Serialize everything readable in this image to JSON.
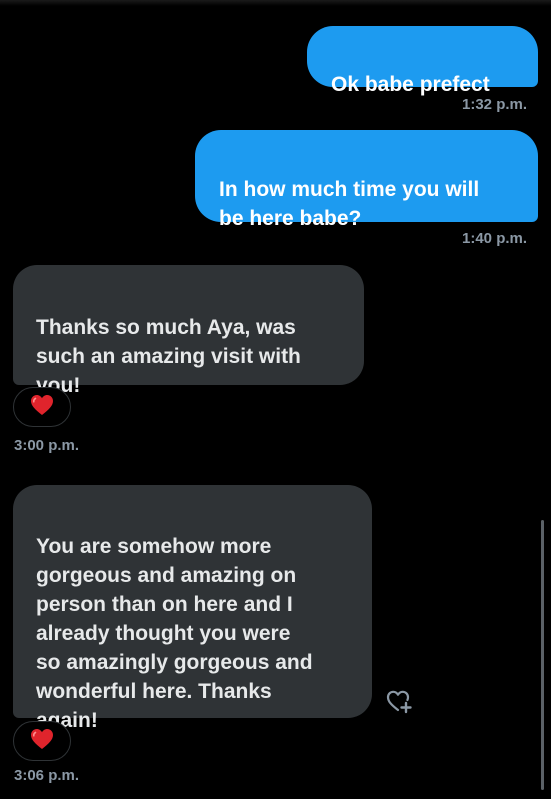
{
  "messages": [
    {
      "direction": "sent",
      "text": "Ok babe prefect",
      "time": "1:32 p.m."
    },
    {
      "direction": "sent",
      "text": "In how much time you will\nbe here babe?",
      "time": "1:40 p.m."
    },
    {
      "direction": "received",
      "text": "Thanks so much Aya, was\nsuch an amazing visit with\nyou!",
      "reaction": "heart",
      "time": "3:00 p.m."
    },
    {
      "direction": "received",
      "text": "You are somehow more\ngorgeous and amazing on\nperson than on here and I\nalready thought you were\nso amazingly gorgeous and\nwonderful here. Thanks\nagain!",
      "reaction": "heart",
      "time": "3:06 p.m."
    }
  ],
  "icons": {
    "reaction": "red-heart-icon",
    "add_reaction": "heart-plus-icon"
  },
  "colors": {
    "background": "#000000",
    "sent_bubble": "#1d9bf0",
    "received_bubble": "#2f3336",
    "timestamp": "#8b98a5",
    "heart": "#e0242c"
  }
}
